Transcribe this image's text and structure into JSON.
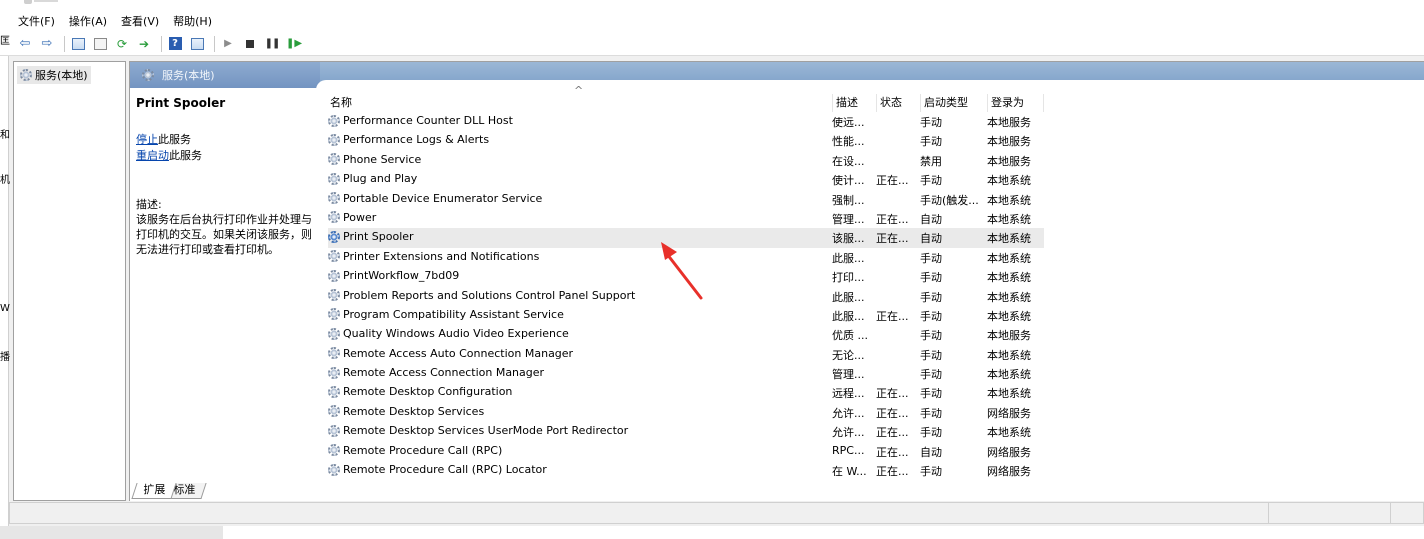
{
  "menubar": {
    "items": [
      "文件(F)",
      "操作(A)",
      "查看(V)",
      "帮助(H)"
    ]
  },
  "toolbar": {
    "icons": [
      "back-arrow-icon",
      "forward-arrow-icon",
      "console-tree-icon",
      "properties-icon",
      "refresh-icon",
      "export-list-icon",
      "help-icon",
      "show-action-pane-icon",
      "start-service-icon",
      "stop-service-icon",
      "pause-service-icon",
      "restart-service-icon"
    ]
  },
  "left_edge": {
    "fragments": [
      "匡",
      "和",
      "机",
      "W",
      "播"
    ]
  },
  "tree": {
    "root_label": "服务(本地)"
  },
  "main": {
    "header_title": "服务(本地)",
    "selected_service": {
      "name": "Print Spooler",
      "stop_link": "停止",
      "stop_suffix": "此服务",
      "restart_link": "重启动",
      "restart_suffix": "此服务",
      "desc_label": "描述:",
      "description": "该服务在后台执行打印作业并处理与打印机的交互。如果关闭该服务，则无法进行打印或查看打印机。"
    },
    "columns": {
      "name": "名称",
      "desc": "描述",
      "status": "状态",
      "startup": "启动类型",
      "logon": "登录为"
    },
    "rows": [
      {
        "name": "Performance Counter DLL Host",
        "desc": "使远...",
        "status": "",
        "startup": "手动",
        "logon": "本地服务"
      },
      {
        "name": "Performance Logs & Alerts",
        "desc": "性能...",
        "status": "",
        "startup": "手动",
        "logon": "本地服务"
      },
      {
        "name": "Phone Service",
        "desc": "在设...",
        "status": "",
        "startup": "禁用",
        "logon": "本地服务"
      },
      {
        "name": "Plug and Play",
        "desc": "使计...",
        "status": "正在...",
        "startup": "手动",
        "logon": "本地系统"
      },
      {
        "name": "Portable Device Enumerator Service",
        "desc": "强制...",
        "status": "",
        "startup": "手动(触发...",
        "logon": "本地系统"
      },
      {
        "name": "Power",
        "desc": "管理...",
        "status": "正在...",
        "startup": "自动",
        "logon": "本地系统"
      },
      {
        "name": "Print Spooler",
        "desc": "该服...",
        "status": "正在...",
        "startup": "自动",
        "logon": "本地系统",
        "selected": true
      },
      {
        "name": "Printer Extensions and Notifications",
        "desc": "此服...",
        "status": "",
        "startup": "手动",
        "logon": "本地系统"
      },
      {
        "name": "PrintWorkflow_7bd09",
        "desc": "打印...",
        "status": "",
        "startup": "手动",
        "logon": "本地系统"
      },
      {
        "name": "Problem Reports and Solutions Control Panel Support",
        "desc": "此服...",
        "status": "",
        "startup": "手动",
        "logon": "本地系统"
      },
      {
        "name": "Program Compatibility Assistant Service",
        "desc": "此服...",
        "status": "正在...",
        "startup": "手动",
        "logon": "本地系统"
      },
      {
        "name": "Quality Windows Audio Video Experience",
        "desc": "优质 ...",
        "status": "",
        "startup": "手动",
        "logon": "本地服务"
      },
      {
        "name": "Remote Access Auto Connection Manager",
        "desc": "无论...",
        "status": "",
        "startup": "手动",
        "logon": "本地系统"
      },
      {
        "name": "Remote Access Connection Manager",
        "desc": "管理...",
        "status": "",
        "startup": "手动",
        "logon": "本地系统"
      },
      {
        "name": "Remote Desktop Configuration",
        "desc": "远程...",
        "status": "正在...",
        "startup": "手动",
        "logon": "本地系统"
      },
      {
        "name": "Remote Desktop Services",
        "desc": "允许...",
        "status": "正在...",
        "startup": "手动",
        "logon": "网络服务"
      },
      {
        "name": "Remote Desktop Services UserMode Port Redirector",
        "desc": "允许...",
        "status": "正在...",
        "startup": "手动",
        "logon": "本地系统"
      },
      {
        "name": "Remote Procedure Call (RPC)",
        "desc": "RPC...",
        "status": "正在...",
        "startup": "自动",
        "logon": "网络服务"
      },
      {
        "name": "Remote Procedure Call (RPC) Locator",
        "desc": "在 W...",
        "status": "正在...",
        "startup": "手动",
        "logon": "网络服务"
      }
    ],
    "tabs": [
      "扩展",
      "标准"
    ]
  },
  "colors": {
    "header_gradient_top": "#9bb7d6",
    "header_gradient_bottom": "#7da0c8",
    "link": "#0645ad",
    "annotation_arrow": "#e8302a",
    "selected_row": "#eaeaea"
  }
}
